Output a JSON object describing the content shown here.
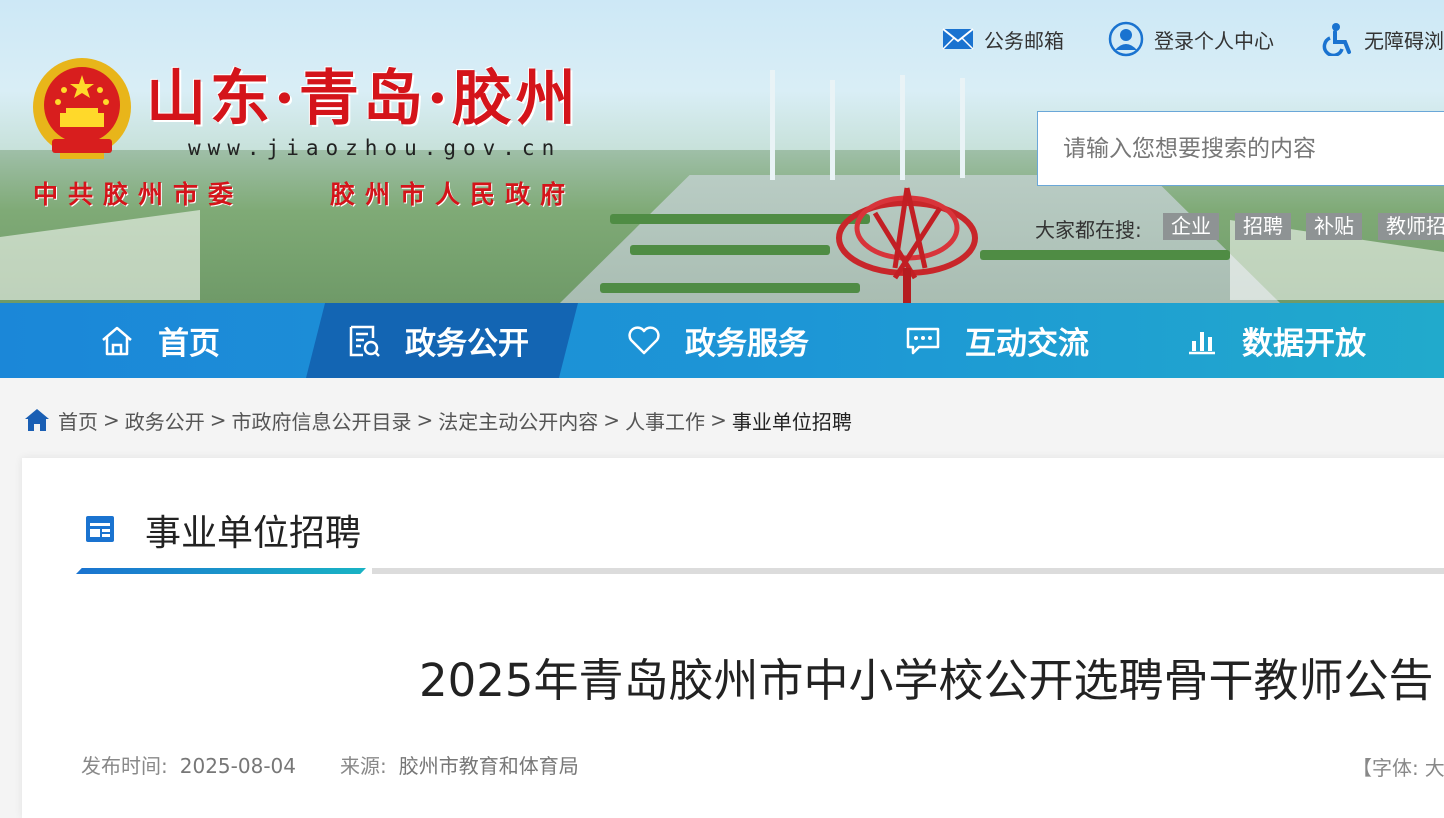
{
  "header": {
    "logo_title": "山东·青岛·胶州",
    "logo_url": "www.jiaozhou.gov.cn",
    "logo_sub_left": "中共胶州市委",
    "logo_sub_right": "胶州市人民政府",
    "top_links": [
      "公务邮箱",
      "登录个人中心",
      "无障碍浏"
    ],
    "search_placeholder": "请输入您想要搜索的内容",
    "hot_label": "大家都在搜:",
    "hot_tags": [
      "企业",
      "招聘",
      "补贴",
      "教师招"
    ]
  },
  "nav": {
    "items": [
      "首页",
      "政务公开",
      "政务服务",
      "互动交流",
      "数据开放"
    ],
    "active_index": 1
  },
  "breadcrumb": [
    "首页",
    "政务公开",
    "市政府信息公开目录",
    "法定主动公开内容",
    "人事工作",
    "事业单位招聘"
  ],
  "section": {
    "title": "事业单位招聘"
  },
  "article": {
    "title": "2025年青岛胶州市中小学校公开选聘骨干教师公告",
    "publish_label": "发布时间:",
    "publish_date": "2025-08-04",
    "source_label": "来源:",
    "source": "胶州市教育和体育局",
    "font_label": "【字体:",
    "font_size_first": "大"
  },
  "colors": {
    "nav_start": "#1b87d8",
    "nav_active": "#1365b3",
    "logo_red": "#d4141a",
    "accent_blue": "#1a73d0"
  },
  "icons": [
    "mail-icon",
    "user-icon",
    "accessibility-icon",
    "home-icon",
    "document-icon",
    "heart-icon",
    "chat-icon",
    "bar-chart-icon",
    "breadcrumb-home-icon",
    "section-icon"
  ]
}
